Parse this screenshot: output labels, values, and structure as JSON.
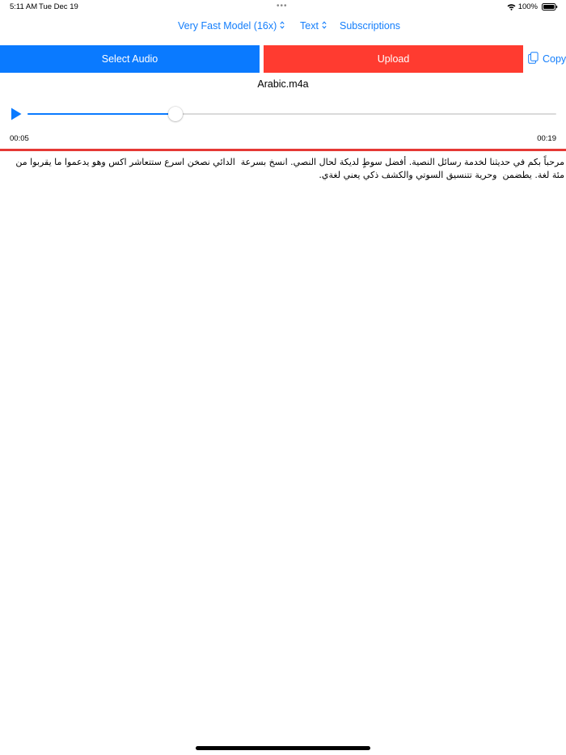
{
  "status_bar": {
    "time": "5:11 AM",
    "date": "Tue Dec 19",
    "battery": "100%",
    "multitask_dots": "•••"
  },
  "nav": {
    "model_label": "Very Fast Model (16x)",
    "format_label": "Text",
    "subscriptions_label": "Subscriptions"
  },
  "actions": {
    "select_audio_label": "Select Audio",
    "upload_label": "Upload",
    "copy_label": "Copy"
  },
  "audio": {
    "file_name": "Arabic.m4a",
    "current_time": "00:05",
    "total_time": "00:19",
    "progress_fraction": 0.28
  },
  "transcript": {
    "text": "مرحباً بكم في حديثنا لخدمة رسائل النصية. أفضل سوطٍ لديكة لحال النصي. انسخ بسرعة  الدائي نصخن اسرع ستتعاشر اكس وهو يدعموا ما يقربوا من مئة لغة. يطضمن  وحرية تتنسيق السوتي والكشف ذكي يعني لغةي."
  },
  "colors": {
    "accent_blue": "#0A7AFF",
    "link_blue": "#147EFB",
    "upload_red": "#FF3B30",
    "divider_red": "#E53935"
  }
}
